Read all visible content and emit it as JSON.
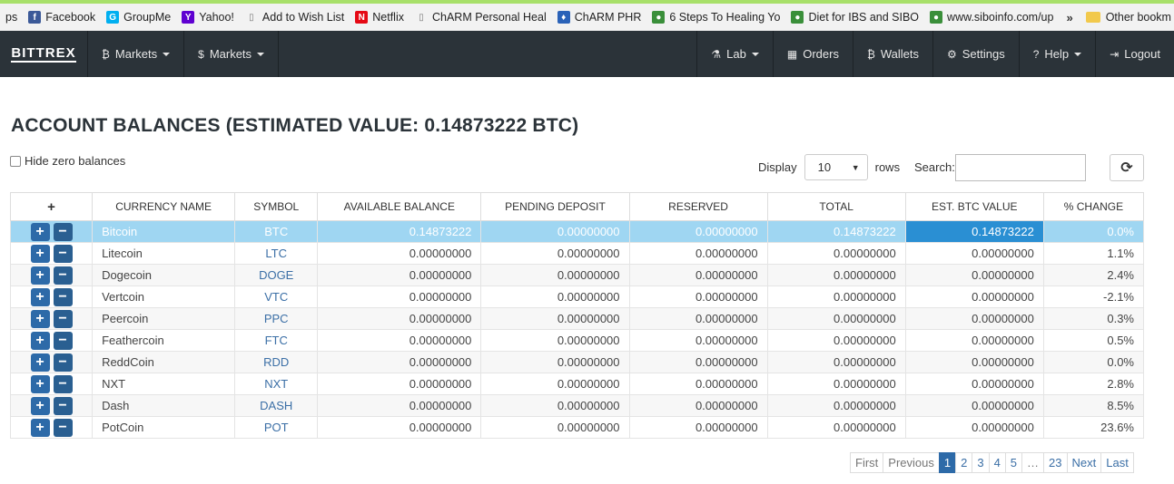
{
  "bookmarks": [
    {
      "label": "ps",
      "icon": "apps-icon"
    },
    {
      "label": "Facebook",
      "icon": "facebook-icon"
    },
    {
      "label": "GroupMe",
      "icon": "groupme-icon"
    },
    {
      "label": "Yahoo!",
      "icon": "yahoo-icon"
    },
    {
      "label": "Add to Wish List",
      "icon": "page-icon"
    },
    {
      "label": "Netflix",
      "icon": "netflix-icon"
    },
    {
      "label": "ChARM Personal Heal",
      "icon": "page-icon"
    },
    {
      "label": "ChARM PHR",
      "icon": "charm-icon"
    },
    {
      "label": "6 Steps To Healing Yo",
      "icon": "site-icon"
    },
    {
      "label": "Diet for IBS and SIBO",
      "icon": "site-icon"
    },
    {
      "label": "www.siboinfo.com/up",
      "icon": "site-icon"
    }
  ],
  "bookmarks_more": "»",
  "other_bookmarks": "Other bookm",
  "nav": {
    "brand": "BITTREX",
    "left": [
      {
        "label": "Markets",
        "icon": "₿"
      },
      {
        "label": "Markets",
        "icon": "$"
      }
    ],
    "right": [
      {
        "label": "Lab",
        "icon": "⚗",
        "caret": true
      },
      {
        "label": "Orders",
        "icon": "▦",
        "caret": false
      },
      {
        "label": "Wallets",
        "icon": "₿",
        "caret": false
      },
      {
        "label": "Settings",
        "icon": "⚙",
        "caret": false
      },
      {
        "label": "Help",
        "icon": "?",
        "caret": true
      },
      {
        "label": "Logout",
        "icon": "⇥",
        "caret": false
      }
    ]
  },
  "page": {
    "title": "ACCOUNT BALANCES (ESTIMATED VALUE: 0.14873222 BTC)",
    "hide_zero_label": "Hide zero balances",
    "display_label": "Display",
    "display_value": "10",
    "rows_label": "rows",
    "search_label": "Search:",
    "search_value": ""
  },
  "table": {
    "headers": [
      "+",
      "CURRENCY NAME",
      "SYMBOL",
      "AVAILABLE BALANCE",
      "PENDING DEPOSIT",
      "RESERVED",
      "TOTAL",
      "EST. BTC VALUE",
      "% CHANGE"
    ],
    "rows": [
      {
        "name": "Bitcoin",
        "symbol": "BTC",
        "available": "0.14873222",
        "pending": "0.00000000",
        "reserved": "0.00000000",
        "total": "0.14873222",
        "est": "0.14873222",
        "change": "0.0%"
      },
      {
        "name": "Litecoin",
        "symbol": "LTC",
        "available": "0.00000000",
        "pending": "0.00000000",
        "reserved": "0.00000000",
        "total": "0.00000000",
        "est": "0.00000000",
        "change": "1.1%"
      },
      {
        "name": "Dogecoin",
        "symbol": "DOGE",
        "available": "0.00000000",
        "pending": "0.00000000",
        "reserved": "0.00000000",
        "total": "0.00000000",
        "est": "0.00000000",
        "change": "2.4%"
      },
      {
        "name": "Vertcoin",
        "symbol": "VTC",
        "available": "0.00000000",
        "pending": "0.00000000",
        "reserved": "0.00000000",
        "total": "0.00000000",
        "est": "0.00000000",
        "change": "-2.1%"
      },
      {
        "name": "Peercoin",
        "symbol": "PPC",
        "available": "0.00000000",
        "pending": "0.00000000",
        "reserved": "0.00000000",
        "total": "0.00000000",
        "est": "0.00000000",
        "change": "0.3%"
      },
      {
        "name": "Feathercoin",
        "symbol": "FTC",
        "available": "0.00000000",
        "pending": "0.00000000",
        "reserved": "0.00000000",
        "total": "0.00000000",
        "est": "0.00000000",
        "change": "0.5%"
      },
      {
        "name": "ReddCoin",
        "symbol": "RDD",
        "available": "0.00000000",
        "pending": "0.00000000",
        "reserved": "0.00000000",
        "total": "0.00000000",
        "est": "0.00000000",
        "change": "0.0%"
      },
      {
        "name": "NXT",
        "symbol": "NXT",
        "available": "0.00000000",
        "pending": "0.00000000",
        "reserved": "0.00000000",
        "total": "0.00000000",
        "est": "0.00000000",
        "change": "2.8%"
      },
      {
        "name": "Dash",
        "symbol": "DASH",
        "available": "0.00000000",
        "pending": "0.00000000",
        "reserved": "0.00000000",
        "total": "0.00000000",
        "est": "0.00000000",
        "change": "8.5%"
      },
      {
        "name": "PotCoin",
        "symbol": "POT",
        "available": "0.00000000",
        "pending": "0.00000000",
        "reserved": "0.00000000",
        "total": "0.00000000",
        "est": "0.00000000",
        "change": "23.6%"
      }
    ],
    "selected_row": 0
  },
  "pagination": [
    "First",
    "Previous",
    "1",
    "2",
    "3",
    "4",
    "5",
    "…",
    "23",
    "Next",
    "Last"
  ],
  "pagination_active": "1",
  "colors": {
    "navbar": "#2b3339",
    "selected_row": "#9fd6f2",
    "selected_est": "#2a8fd3",
    "button": "#2d6aa8",
    "link": "#3b6fa6"
  }
}
